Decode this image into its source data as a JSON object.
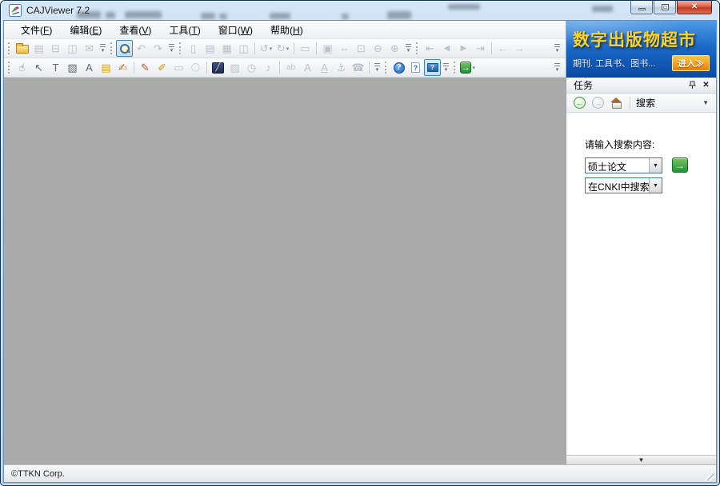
{
  "window": {
    "title": "CAJViewer 7.2"
  },
  "menu": {
    "items": [
      {
        "key": "file",
        "label": "文件",
        "accel": "F"
      },
      {
        "key": "edit",
        "label": "编辑",
        "accel": "E"
      },
      {
        "key": "view",
        "label": "查看",
        "accel": "V"
      },
      {
        "key": "tools",
        "label": "工具",
        "accel": "T"
      },
      {
        "key": "window",
        "label": "窗口",
        "accel": "W"
      },
      {
        "key": "help",
        "label": "帮助",
        "accel": "H"
      }
    ]
  },
  "toolbars": {
    "row1": [
      {
        "t": "grip"
      },
      {
        "t": "btn",
        "n": "open",
        "i": "folder",
        "s": "on"
      },
      {
        "t": "btn",
        "n": "save",
        "g": "▤",
        "s": "off"
      },
      {
        "t": "btn",
        "n": "print",
        "g": "⊟",
        "s": "off"
      },
      {
        "t": "btn",
        "n": "print-preview",
        "g": "◫",
        "s": "off"
      },
      {
        "t": "btn",
        "n": "mail-document",
        "g": "✉",
        "s": "off"
      },
      {
        "t": "chev"
      },
      {
        "t": "grip"
      },
      {
        "t": "btn",
        "n": "find",
        "i": "mag",
        "s": "sel"
      },
      {
        "t": "btn",
        "n": "undo",
        "g": "↶",
        "s": "off"
      },
      {
        "t": "btn",
        "n": "redo",
        "g": "↷",
        "s": "off"
      },
      {
        "t": "chev"
      },
      {
        "t": "grip"
      },
      {
        "t": "btn",
        "n": "single-page",
        "g": "▯",
        "s": "off"
      },
      {
        "t": "btn",
        "n": "continuous-page",
        "g": "▤",
        "s": "off"
      },
      {
        "t": "btn",
        "n": "continuous-facing",
        "g": "▦",
        "s": "off"
      },
      {
        "t": "btn",
        "n": "facing-page",
        "g": "◫",
        "s": "off"
      },
      {
        "t": "sep"
      },
      {
        "t": "btn",
        "n": "rotate-left",
        "g": "↺",
        "s": "off",
        "dd": true
      },
      {
        "t": "btn",
        "n": "rotate-right",
        "g": "↻",
        "s": "off",
        "dd": true
      },
      {
        "t": "sep"
      },
      {
        "t": "btn",
        "n": "full-screen",
        "g": "▭",
        "s": "off"
      },
      {
        "t": "sep"
      },
      {
        "t": "btn",
        "n": "fit-page",
        "g": "▣",
        "s": "off"
      },
      {
        "t": "btn",
        "n": "fit-width",
        "g": "⇔",
        "s": "off"
      },
      {
        "t": "btn",
        "n": "actual-size",
        "g": "⊡",
        "s": "off"
      },
      {
        "t": "btn",
        "n": "zoom-out",
        "g": "⊖",
        "s": "off"
      },
      {
        "t": "btn",
        "n": "zoom-in",
        "g": "⊕",
        "s": "off"
      },
      {
        "t": "chev"
      },
      {
        "t": "grip"
      },
      {
        "t": "btn",
        "n": "first-page",
        "g": "⇤",
        "s": "off"
      },
      {
        "t": "btn",
        "n": "prev-page",
        "g": "◀",
        "s": "off",
        "sm": true
      },
      {
        "t": "btn",
        "n": "next-page",
        "g": "▶",
        "s": "off",
        "sm": true
      },
      {
        "t": "btn",
        "n": "last-page",
        "g": "⇥",
        "s": "off"
      },
      {
        "t": "sep"
      },
      {
        "t": "btn",
        "n": "go-back",
        "g": "←",
        "s": "off"
      },
      {
        "t": "btn",
        "n": "go-forward",
        "g": "→",
        "s": "off"
      },
      {
        "t": "chev",
        "end": true
      }
    ],
    "row2": [
      {
        "t": "grip"
      },
      {
        "t": "btn",
        "n": "hand-tool",
        "g": "☝",
        "s": "on"
      },
      {
        "t": "btn",
        "n": "select-tool",
        "g": "↖",
        "s": "on"
      },
      {
        "t": "btn",
        "n": "text-select-tool",
        "g": "T",
        "s": "on"
      },
      {
        "t": "btn",
        "n": "image-select-tool",
        "g": "▧",
        "s": "on"
      },
      {
        "t": "btn",
        "n": "text-recognize-tool",
        "g": "A",
        "s": "on"
      },
      {
        "t": "btn",
        "n": "add-note",
        "g": "▤",
        "s": "on",
        "c": "#d9a520"
      },
      {
        "t": "btn",
        "n": "edit-annotation",
        "g": "✍",
        "s": "on",
        "c": "#b07830"
      },
      {
        "t": "sep"
      },
      {
        "t": "btn",
        "n": "line-tool",
        "g": "✎",
        "s": "on",
        "c": "#a65940"
      },
      {
        "t": "btn",
        "n": "highlight-tool",
        "g": "✐",
        "s": "on",
        "c": "#c79a2a"
      },
      {
        "t": "btn",
        "n": "rectangle-tool",
        "g": "▭",
        "s": "off"
      },
      {
        "t": "btn",
        "n": "ellipse-tool",
        "g": "◯",
        "s": "off",
        "sm": true
      },
      {
        "t": "sep"
      },
      {
        "t": "btn",
        "n": "knowledge-tool",
        "i": "navy",
        "s": "on"
      },
      {
        "t": "btn",
        "n": "image-annotation",
        "g": "▧",
        "s": "off"
      },
      {
        "t": "btn",
        "n": "timer-annotation",
        "g": "◷",
        "s": "off"
      },
      {
        "t": "btn",
        "n": "sound-annotation",
        "g": "♪",
        "s": "off"
      },
      {
        "t": "sep"
      },
      {
        "t": "btn",
        "n": "pinyin-annotation",
        "g": "ab",
        "s": "off",
        "sm": true
      },
      {
        "t": "btn",
        "n": "font-tool",
        "g": "A",
        "s": "off"
      },
      {
        "t": "btn",
        "n": "underline-tool",
        "g": "A",
        "s": "off",
        "u": true
      },
      {
        "t": "btn",
        "n": "anchor-tool",
        "g": "⚓",
        "s": "off"
      },
      {
        "t": "btn",
        "n": "link-tool",
        "g": "☎",
        "s": "off"
      },
      {
        "t": "sep"
      },
      {
        "t": "chev"
      },
      {
        "t": "grip"
      },
      {
        "t": "btn",
        "n": "help",
        "i": "help",
        "s": "on"
      },
      {
        "t": "btn",
        "n": "help-topics",
        "i": "pageq",
        "s": "on"
      },
      {
        "t": "btn",
        "n": "help-online",
        "i": "screenq",
        "s": "sel"
      },
      {
        "t": "chev"
      },
      {
        "t": "grip"
      },
      {
        "t": "btn",
        "n": "cnki-search",
        "i": "go",
        "s": "on",
        "dd": true
      },
      {
        "t": "chev",
        "end": true
      }
    ]
  },
  "banner": {
    "title": "数字出版物超市",
    "subtitle": "期刊. 工具书、图书...",
    "enter_label": "进入≫"
  },
  "task": {
    "title": "任务",
    "tab_label": "搜索",
    "prompt": "请输入搜索内容:",
    "keyword_value": "硕士论文",
    "scope_value": "在CNKI中搜索"
  },
  "statusbar": {
    "copyright": "©TTKN Corp."
  },
  "colors": {
    "banner_blue_top": "#4c9ae8",
    "banner_blue_bottom": "#0a4aa4",
    "banner_title_yellow": "#ffd21e",
    "enter_orange": "#f07c00",
    "go_green": "#1e9338",
    "content_gray": "#ababab",
    "titlebar_blue": "#bcd6ee",
    "close_red": "#c23a22"
  }
}
